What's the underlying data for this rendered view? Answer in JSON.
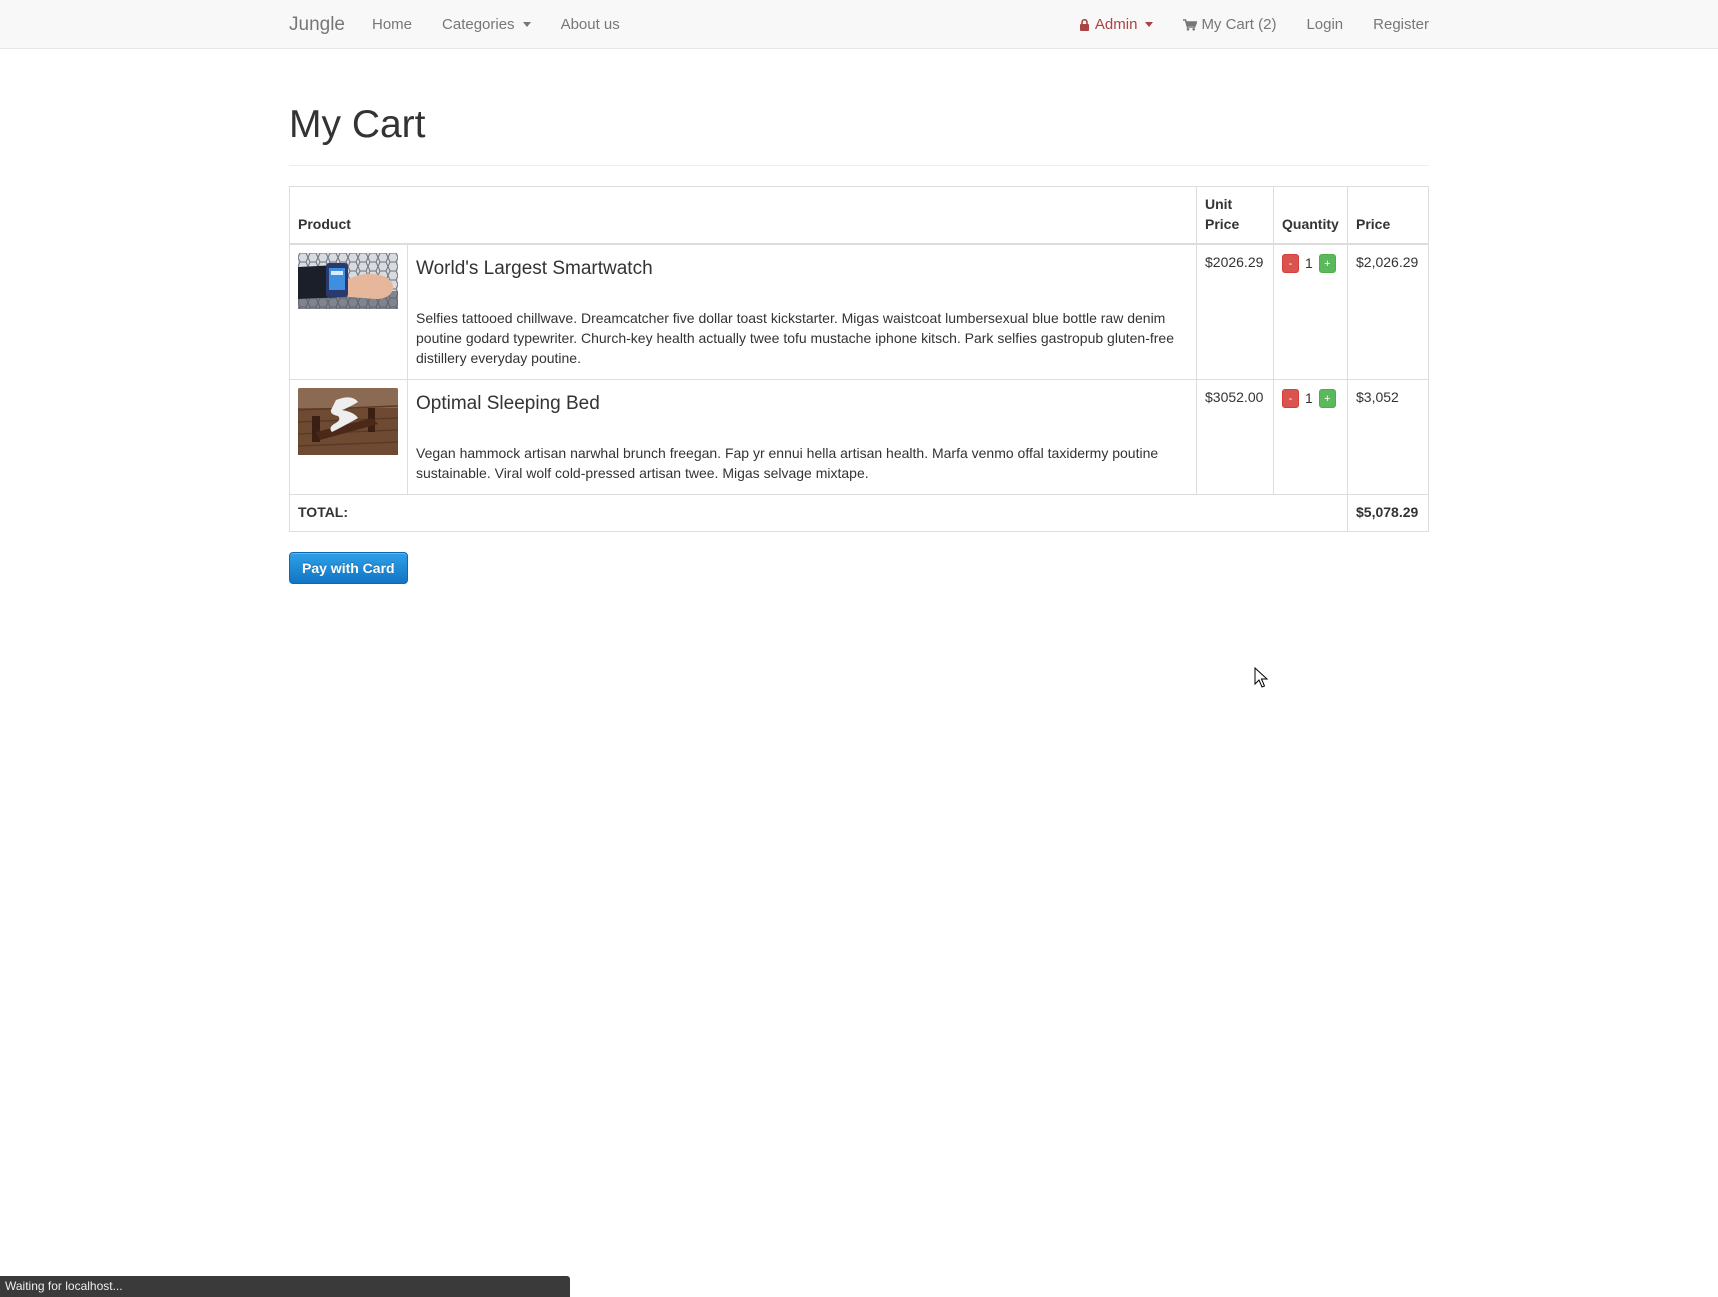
{
  "navbar": {
    "brand": "Jungle",
    "left_links": [
      "Home",
      "Categories",
      "About us"
    ],
    "admin_label": "Admin",
    "cart_label": "My Cart (2)",
    "login_label": "Login",
    "register_label": "Register"
  },
  "page": {
    "title": "My Cart"
  },
  "table": {
    "headers": {
      "product": "Product",
      "unit_price": "Unit Price",
      "quantity": "Quantity",
      "price": "Price"
    },
    "rows": [
      {
        "name": "World's Largest Smartwatch",
        "description": "Selfies tattooed chillwave. Dreamcatcher five dollar toast kickstarter. Migas waistcoat lumbersexual blue bottle raw denim poutine godard typewriter. Church-key health actually twee tofu mustache iphone kitsch. Park selfies gastropub gluten-free distillery everyday poutine.",
        "unit_price": "$2026.29",
        "quantity": "1",
        "price": "$2,026.29",
        "image_icon": "smartwatch-photo"
      },
      {
        "name": "Optimal Sleeping Bed",
        "description": "Vegan hammock artisan narwhal brunch freegan. Fap yr ennui hella artisan health. Marfa venmo offal taxidermy poutine sustainable. Viral wolf cold-pressed artisan twee. Migas selvage mixtape.",
        "unit_price": "$3052.00",
        "quantity": "1",
        "price": "$3,052",
        "image_icon": "bed-photo"
      }
    ],
    "minus_label": "-",
    "plus_label": "+",
    "total_label": "TOTAL:",
    "total_value": "$5,078.29"
  },
  "pay_button": "Pay with Card",
  "status_bar": "Waiting for localhost...",
  "colors": {
    "navbar_bg": "#f8f8f8",
    "admin": "#a94442",
    "minus": "#d9534f",
    "plus": "#5cb85c",
    "pay_button": "#1a85d1"
  }
}
